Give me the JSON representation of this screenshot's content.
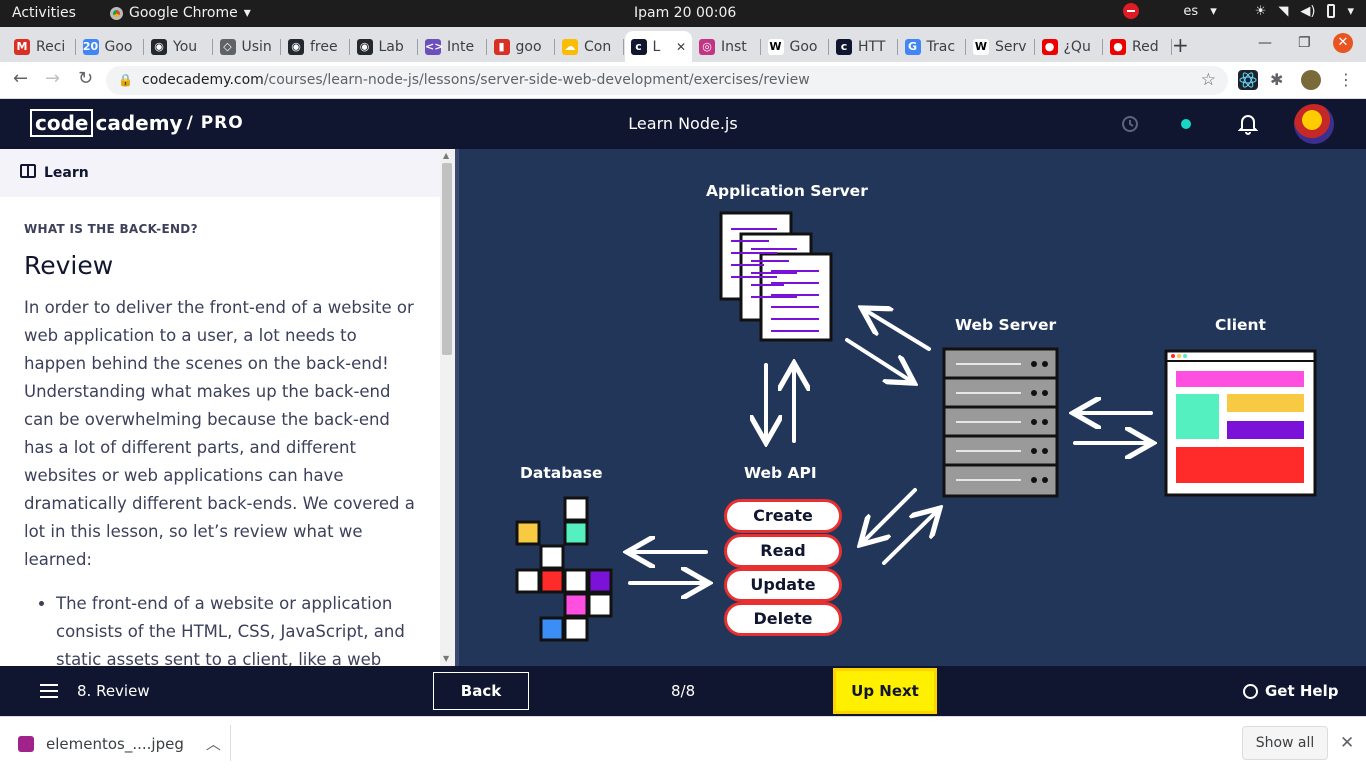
{
  "os_bar": {
    "activities": "Activities",
    "app_name": "Google Chrome",
    "app_caret": "▾",
    "clock": "Ipam 20  00:06",
    "language": "es",
    "lang_caret": "▾"
  },
  "tabs": [
    {
      "label": "Reci",
      "icon": "gmail-icon",
      "color": "#d93025",
      "glyph": "M"
    },
    {
      "label": "Goo",
      "icon": "calendar-icon",
      "color": "#4285f4",
      "glyph": "20"
    },
    {
      "label": "You",
      "icon": "github-icon",
      "color": "#24292f",
      "glyph": "◉"
    },
    {
      "label": "Usin",
      "icon": "site-icon",
      "color": "#5f6368",
      "glyph": "◇"
    },
    {
      "label": "free",
      "icon": "github-icon",
      "color": "#24292f",
      "glyph": "◉"
    },
    {
      "label": "Lab",
      "icon": "github-icon",
      "color": "#24292f",
      "glyph": "◉"
    },
    {
      "label": "Inte",
      "icon": "code-icon",
      "color": "#6b4fbb",
      "glyph": "<>"
    },
    {
      "label": "goo",
      "icon": "bookmark-icon",
      "color": "#d93025",
      "glyph": "▮"
    },
    {
      "label": "Con",
      "icon": "cloud-icon",
      "color": "#fbbc04",
      "glyph": "☁"
    },
    {
      "label": "L",
      "icon": "codecademy-icon",
      "color": "#10162f",
      "glyph": "c"
    },
    {
      "label": "Inst",
      "icon": "instagram-icon",
      "color": "#c13584",
      "glyph": "◎"
    },
    {
      "label": "Goo",
      "icon": "wikipedia-icon",
      "color": "#ffffff",
      "glyph": "W"
    },
    {
      "label": "HTT",
      "icon": "codecademy-icon",
      "color": "#10162f",
      "glyph": "c"
    },
    {
      "label": "Trac",
      "icon": "translate-icon",
      "color": "#4285f4",
      "glyph": "G"
    },
    {
      "label": "Serv",
      "icon": "wikipedia-icon",
      "color": "#ffffff",
      "glyph": "W"
    },
    {
      "label": "¿Qu",
      "icon": "redhat-icon",
      "color": "#ee0000",
      "glyph": "●"
    },
    {
      "label": "Red",
      "icon": "redhat-icon",
      "color": "#ee0000",
      "glyph": "●"
    }
  ],
  "toolbar": {
    "url_host": "codecademy.com",
    "url_path": "/courses/learn-node-js/lessons/server-side-web-development/exercises/review",
    "back": "←",
    "forward": "→",
    "reload": "↻",
    "lock": "🔒",
    "star": "☆"
  },
  "cc_header": {
    "logo_code": "code",
    "logo_cademy": "cademy",
    "logo_pro": "/ PRO",
    "course_title": "Learn Node.js"
  },
  "learn": {
    "header": "Learn",
    "eyebrow": "WHAT IS THE BACK-END?",
    "title": "Review",
    "paragraph": "In order to deliver the front-end of a website or web application to a user, a lot needs to happen behind the scenes on the back-end! Understanding what makes up the back-end can be overwhelming because the back-end has a lot of different parts, and different websites or web applications can have dramatically different back-ends. We covered a lot in this lesson, so let’s review what we learned:",
    "bullet_1": "The front-end of a website or application consists of the HTML, CSS, JavaScript, and static assets sent to a client, like a web browser."
  },
  "diagram": {
    "app_server": "Application Server",
    "web_server": "Web Server",
    "client": "Client",
    "database": "Database",
    "web_api": "Web API",
    "crud": [
      "Create",
      "Read",
      "Update",
      "Delete"
    ],
    "colors": {
      "bg": "#22365a",
      "red": "#ff2a2a",
      "pink": "#ff4fe0",
      "teal": "#55f0c0",
      "yellow": "#f8c942",
      "purple": "#7b12d8",
      "blue": "#3a8ef6"
    }
  },
  "bottom": {
    "lesson": "8. Review",
    "back": "Back",
    "progress": "8/8",
    "up_next": "Up Next",
    "get_help": "Get Help"
  },
  "downloads": {
    "file": "elementos_....jpeg",
    "show_all": "Show all",
    "close": "✕"
  }
}
